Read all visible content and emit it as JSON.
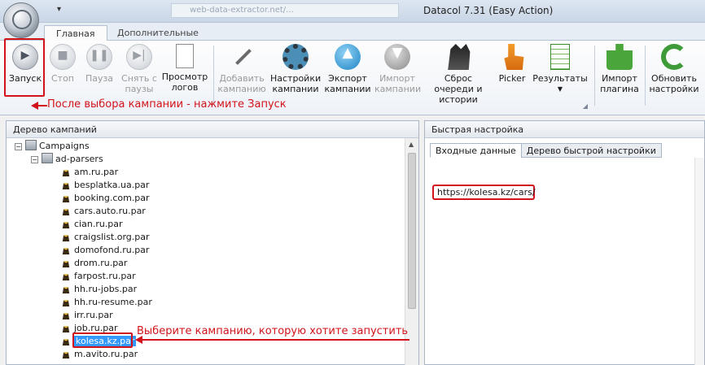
{
  "window": {
    "title": "Datacol 7.31 (Easy Action)",
    "address": "web-data-extractor.net/..."
  },
  "tabs": [
    {
      "label": "Главная",
      "active": true
    },
    {
      "label": "Дополнительные",
      "active": false
    }
  ],
  "ribbon": {
    "start": "Запуск",
    "stop": "Стоп",
    "pause": "Пауза",
    "unpause": "Снять с паузы",
    "view_logs": "Просмотр логов",
    "add_campaign": "Добавить кампанию",
    "campaign_settings": "Настройки кампании",
    "export_campaign": "Экспорт кампании",
    "import_campaign": "Импорт кампании",
    "reset_queue": "Сброс очереди и истории",
    "picker": "Picker",
    "results": "Результаты",
    "import_plugin": "Импорт плагина",
    "update_settings": "Обновить настройки"
  },
  "left_panel": {
    "title": "Дерево кампаний",
    "root": "Campaigns",
    "folder": "ad-parsers",
    "items": [
      "am.ru.par",
      "besplatka.ua.par",
      "booking.com.par",
      "cars.auto.ru.par",
      "cian.ru.par",
      "craigslist.org.par",
      "domofond.ru.par",
      "drom.ru.par",
      "farpost.ru.par",
      "hh.ru-jobs.par",
      "hh.ru-resume.par",
      "irr.ru.par",
      "job.ru.par",
      "kolesa.kz.par",
      "m.avito.ru.par"
    ],
    "selected": "kolesa.kz.par"
  },
  "right_panel": {
    "title": "Быстрая настройка",
    "tabs": [
      "Входные данные",
      "Дерево быстрой настройки"
    ],
    "input_url": "https://kolesa.kz/cars/"
  },
  "annotations": {
    "after_select": "После выбора кампании - нажмите Запуск",
    "choose_campaign": "Выберите кампанию, которую хотите запустить"
  },
  "colors": {
    "annotation": "#d1141b",
    "selection": "#3399ff"
  }
}
